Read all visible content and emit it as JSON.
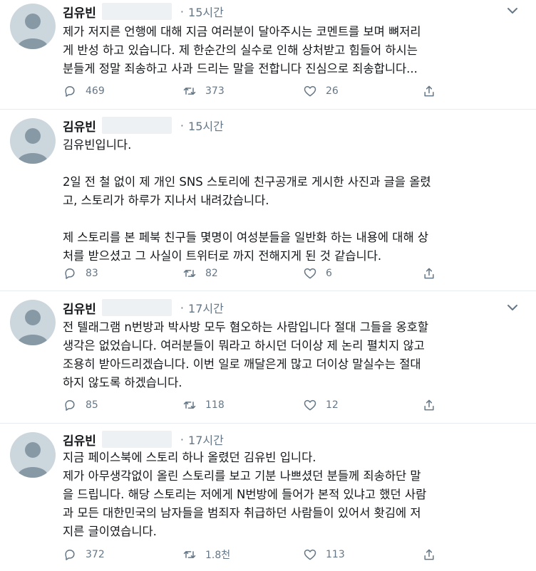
{
  "tweets": [
    {
      "name": "김유빈",
      "separator": "·",
      "time": "15시간",
      "text": "제가 저지른 언행에 대해 지금 여러분이 달아주시는 코멘트를 보며 뼈저리\n게 반성 하고 있습니다. 제 한순간의 실수로 인해 상처받고 힘들어 하시는\n분들게 정말 죄송하고 사과 드리는 말을 전합니다 진심으로 죄송합니다...",
      "replies": "469",
      "retweets": "373",
      "likes": "26"
    },
    {
      "name": "김유빈",
      "separator": "·",
      "time": "15시간",
      "text": "김유빈입니다.\n\n2일 전 철 없이 제 개인 SNS 스토리에 친구공개로 게시한 사진과 글을 올렸\n고, 스토리가 하루가 지나서 내려갔습니다.\n\n제 스토리를 본 페북 친구들 몇명이 여성분들을 일반화 하는 내용에 대해 상\n처를 받으셨고 그 사실이 트위터로 까지 전해지게 된 것 같습니다.",
      "replies": "83",
      "retweets": "82",
      "likes": "6"
    },
    {
      "name": "김유빈",
      "separator": "·",
      "time": "17시간",
      "text": "전 텔래그램 n번방과 박사방 모두 혐오하는 사람입니다 절대 그들을 옹호할\n생각은 없었습니다. 여러분들이 뭐라고 하시던 더이상 제 논리 펼치지 않고\n조용히 받아드리겠습니다. 이번 일로 깨달은게 많고 더이상 말실수는 절대\n하지 않도록 하겠습니다.",
      "replies": "85",
      "retweets": "118",
      "likes": "12"
    },
    {
      "name": "김유빈",
      "separator": "·",
      "time": "17시간",
      "text": "지금 페이스북에 스토리 하나 올렸던 김유빈 입니다.\n제가 아무생각없이 올린 스토리를 보고 기분 나쁘셨던 분들께 죄송하단 말\n을 드립니다. 해당 스토리는 저에게 N번방에 들어가 본적 있냐고 했던 사람\n과 모든 대한민국의 남자들을 범죄자 취급하던 사람들이 있어서 홧김에 저\n지른 글이였습니다.",
      "replies": "372",
      "retweets": "1.8천",
      "likes": "113"
    }
  ],
  "icons": {
    "reply": "reply-icon",
    "retweet": "retweet-icon",
    "like": "heart-icon",
    "share": "share-icon",
    "more": "chevron-down-icon",
    "avatar": "default-avatar-icon"
  },
  "colors": {
    "text": "#14171a",
    "muted": "#657786",
    "divider": "#e6ecf0",
    "avatar_bg": "#ccd6dd"
  }
}
